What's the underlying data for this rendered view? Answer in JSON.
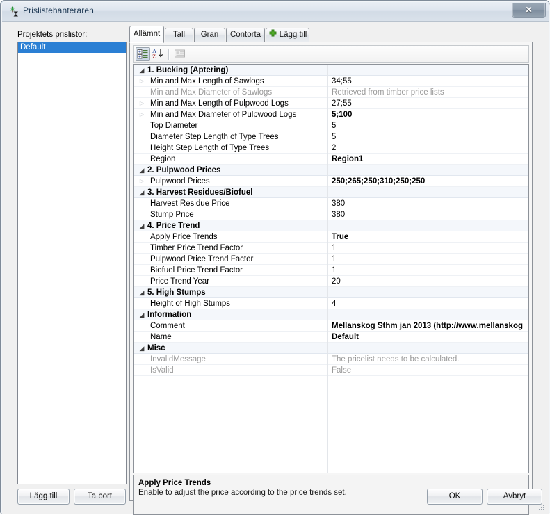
{
  "window": {
    "title": "Prislistehanteraren",
    "app_icon": "tree-hourglass-icon",
    "close_label": "✕"
  },
  "left_panel": {
    "label": "Projektets prislistor:",
    "items": [
      {
        "label": "Default",
        "selected": true
      }
    ],
    "buttons": {
      "add": "Lägg till",
      "remove": "Ta bort"
    }
  },
  "tabs": [
    {
      "label": "Allämnt",
      "active": true
    },
    {
      "label": "Tall",
      "active": false
    },
    {
      "label": "Gran",
      "active": false
    },
    {
      "label": "Contorta",
      "active": false
    },
    {
      "label": "Lägg till",
      "active": false,
      "icon": "plus-icon"
    }
  ],
  "toolbar": {
    "categorized": "categorized-view-icon",
    "alphabetical": "alphabetical-sort-icon",
    "property_pages": "property-pages-icon"
  },
  "property_grid": {
    "rows": [
      {
        "kind": "category",
        "expander": "◢",
        "name": "1. Bucking (Aptering)",
        "value": ""
      },
      {
        "kind": "property",
        "expander": "▷",
        "name": "Min and Max Length of Sawlogs",
        "value": "34;55",
        "bold": false,
        "readonly": false
      },
      {
        "kind": "property",
        "expander": "",
        "name": "Min and Max Diameter of Sawlogs",
        "value": "Retrieved from timber price lists",
        "bold": false,
        "readonly": true
      },
      {
        "kind": "property",
        "expander": "▷",
        "name": "Min and Max Length of Pulpwood Logs",
        "value": "27;55",
        "bold": false,
        "readonly": false
      },
      {
        "kind": "property",
        "expander": "▷",
        "name": "Min and Max Diameter of Pulpwood Logs",
        "value": "5;100",
        "bold": true,
        "readonly": false
      },
      {
        "kind": "property",
        "expander": "",
        "name": "Top Diameter",
        "value": "5",
        "bold": false,
        "readonly": false
      },
      {
        "kind": "property",
        "expander": "",
        "name": "Diameter Step Length of Type Trees",
        "value": "5",
        "bold": false,
        "readonly": false
      },
      {
        "kind": "property",
        "expander": "",
        "name": "Height Step Length of Type Trees",
        "value": "2",
        "bold": false,
        "readonly": false
      },
      {
        "kind": "property",
        "expander": "",
        "name": "Region",
        "value": "Region1",
        "bold": true,
        "readonly": false
      },
      {
        "kind": "category",
        "expander": "◢",
        "name": "2. Pulpwood Prices",
        "value": ""
      },
      {
        "kind": "property",
        "expander": "▷",
        "name": "Pulpwood Prices",
        "value": "250;265;250;310;250;250",
        "bold": true,
        "readonly": false
      },
      {
        "kind": "category",
        "expander": "◢",
        "name": "3. Harvest Residues/Biofuel",
        "value": ""
      },
      {
        "kind": "property",
        "expander": "",
        "name": "Harvest Residue Price",
        "value": "380",
        "bold": false,
        "readonly": false
      },
      {
        "kind": "property",
        "expander": "",
        "name": "Stump Price",
        "value": "380",
        "bold": false,
        "readonly": false
      },
      {
        "kind": "category",
        "expander": "◢",
        "name": "4. Price Trend",
        "value": ""
      },
      {
        "kind": "property",
        "expander": "",
        "name": "Apply Price Trends",
        "value": "True",
        "bold": true,
        "readonly": false
      },
      {
        "kind": "property",
        "expander": "",
        "name": "Timber Price Trend Factor",
        "value": "1",
        "bold": false,
        "readonly": false
      },
      {
        "kind": "property",
        "expander": "",
        "name": "Pulpwood Price Trend Factor",
        "value": "1",
        "bold": false,
        "readonly": false
      },
      {
        "kind": "property",
        "expander": "",
        "name": "Biofuel Price Trend Factor",
        "value": "1",
        "bold": false,
        "readonly": false
      },
      {
        "kind": "property",
        "expander": "",
        "name": "Price Trend Year",
        "value": "20",
        "bold": false,
        "readonly": false
      },
      {
        "kind": "category",
        "expander": "◢",
        "name": "5. High Stumps",
        "value": ""
      },
      {
        "kind": "property",
        "expander": "",
        "name": "Height of High Stumps",
        "value": "4",
        "bold": false,
        "readonly": false
      },
      {
        "kind": "category",
        "expander": "◢",
        "name": "Information",
        "value": ""
      },
      {
        "kind": "property",
        "expander": "",
        "name": "Comment",
        "value": "Mellanskog Sthm jan 2013 (http://www.mellanskog",
        "bold": true,
        "readonly": false
      },
      {
        "kind": "property",
        "expander": "",
        "name": "Name",
        "value": "Default",
        "bold": true,
        "readonly": false
      },
      {
        "kind": "category",
        "expander": "◢",
        "name": "Misc",
        "value": ""
      },
      {
        "kind": "property",
        "expander": "",
        "name": "InvalidMessage",
        "value": "The pricelist needs to be calculated.",
        "bold": false,
        "readonly": true
      },
      {
        "kind": "property",
        "expander": "",
        "name": "IsValid",
        "value": "False",
        "bold": false,
        "readonly": true
      }
    ]
  },
  "description": {
    "title": "Apply Price Trends",
    "text": "Enable to adjust the price according to the price trends set."
  },
  "dialog_buttons": {
    "ok": "OK",
    "cancel": "Avbryt"
  },
  "colors": {
    "selection_blue": "#2a7fd4",
    "category_row": "#f4f7fb",
    "readonly_text": "#9a9a9a",
    "plus_green": "#5cb82e"
  }
}
